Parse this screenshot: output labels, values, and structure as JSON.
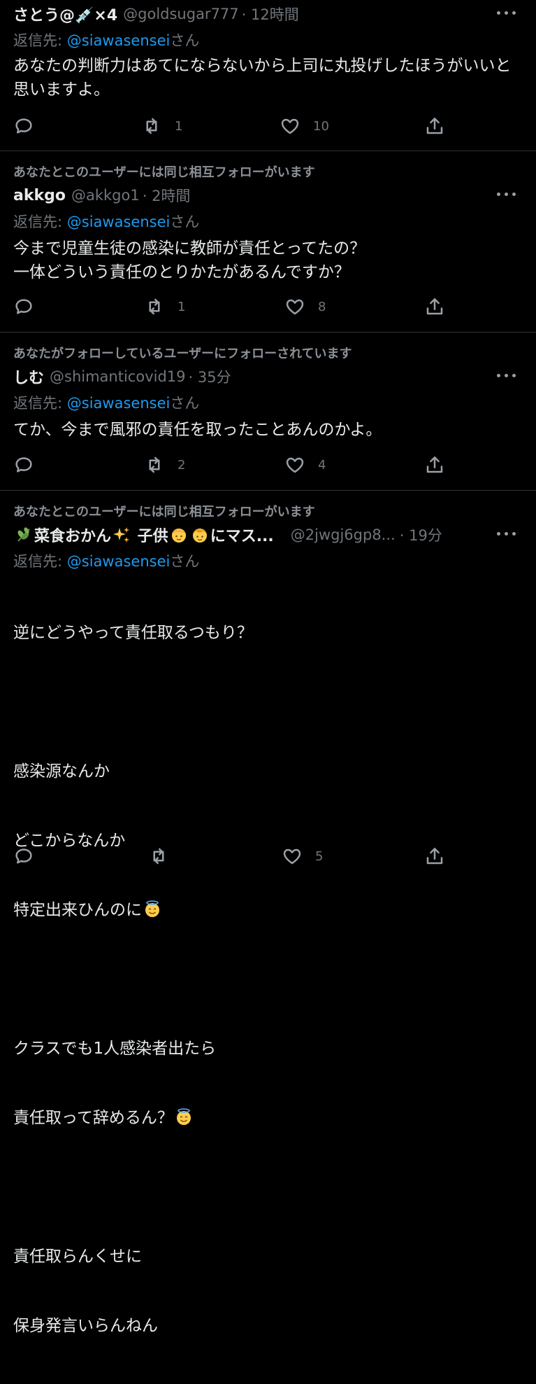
{
  "tweets": [
    {
      "name": "さとう@💉×4",
      "handle": "@goldsugar777",
      "time": "· 12時間",
      "reply_label": "返信先: ",
      "reply_mention": "@siawasensei",
      "reply_suffix": "さん",
      "body": "あなたの判断力はあてにならないから上司に丸投げしたほうがいいと思いますよ。",
      "replies": "",
      "retweets": "1",
      "likes": "10"
    },
    {
      "social": "あなたとこのユーザーには同じ相互フォローがいます",
      "name": "akkgo",
      "handle": "@akkgo1",
      "time": "· 2時間",
      "reply_label": "返信先: ",
      "reply_mention": "@siawasensei",
      "reply_suffix": "さん",
      "body": "今まで児童生徒の感染に教師が責任とってたの？\n一体どういう責任のとりかたがあるんですか？",
      "replies": "",
      "retweets": "1",
      "likes": "8"
    },
    {
      "social": "あなたがフォローしているユーザーにフォローされています",
      "name": "しむ",
      "handle": "@shimanticovid19",
      "time": "· 35分",
      "reply_label": "返信先: ",
      "reply_mention": "@siawasensei",
      "reply_suffix": "さん",
      "body": "てか、今まで風邪の責任を取ったことあんのかよ。",
      "replies": "",
      "retweets": "2",
      "likes": "4"
    },
    {
      "social": "あなたとこのユーザーには同じ相互フォローがいます",
      "name_prefix_emoji": "herb",
      "name_a": "菜食おかん",
      "name_b": " 子供",
      "name_c": "にマス...",
      "handle": "@2jwgj6gp8...",
      "time": "· 19分",
      "reply_label": "返信先: ",
      "reply_mention": "@siawasensei",
      "reply_suffix": "さん",
      "body_1": "逆にどうやって責任取るつもり？",
      "body_2": "感染源なんか",
      "body_3": "どこからなんか",
      "body_4": "特定出来ひんのに",
      "body_5": "クラスでも1人感染者出たら",
      "body_6": "責任取って辞めるん？",
      "body_7": "責任取らんくせに",
      "body_8": "保身発言いらんねん",
      "replies": "",
      "retweets": "",
      "likes": "5"
    }
  ],
  "icons": {
    "reply": "reply-bubble-icon",
    "retweet": "retweet-icon",
    "like": "heart-icon",
    "share": "share-upload-icon",
    "more": "more-dots-icon"
  },
  "colors": {
    "background": "#000000",
    "text": "#e7e9ea",
    "secondary": "#71767b",
    "mention": "#1d9bf0",
    "divider": "#2f3336"
  }
}
